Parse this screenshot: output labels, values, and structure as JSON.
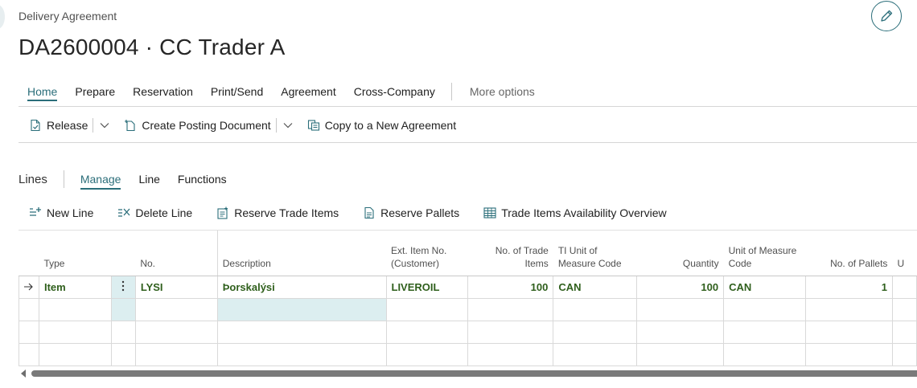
{
  "page": {
    "breadcrumb": "Delivery Agreement",
    "title": "DA2600004 · CC Trader A"
  },
  "tabs": [
    "Home",
    "Prepare",
    "Reservation",
    "Print/Send",
    "Agreement",
    "Cross-Company"
  ],
  "more_options": "More options",
  "actions": {
    "release": "Release",
    "create_posting": "Create Posting Document",
    "copy_agreement": "Copy to a New Agreement"
  },
  "lines": {
    "title": "Lines",
    "tabs": [
      "Manage",
      "Line",
      "Functions"
    ],
    "actions": {
      "new_line": "New Line",
      "delete_line": "Delete Line",
      "reserve_trade_items": "Reserve Trade Items",
      "reserve_pallets": "Reserve Pallets",
      "availability": "Trade Items Availability Overview"
    },
    "columns": {
      "type": "Type",
      "no": "No.",
      "description": "Description",
      "ext_item_no": "Ext. Item No. (Customer)",
      "no_trade_items": "No. of Trade Items",
      "ti_uom": "TI Unit of Measure Code",
      "quantity": "Quantity",
      "uom": "Unit of Measure Code",
      "no_pallets": "No. of Pallets",
      "next": "U"
    },
    "rows": [
      {
        "type": "Item",
        "no": "LYSI",
        "description": "Þorskalýsi",
        "ext_item_no": "LIVEROIL",
        "no_trade_items": "100",
        "ti_uom": "CAN",
        "quantity": "100",
        "uom": "CAN",
        "no_pallets": "1"
      }
    ]
  },
  "colors": {
    "accent": "#2b6e7a",
    "row_value": "#2f5f1c",
    "selected_cell": "#dceef0"
  }
}
